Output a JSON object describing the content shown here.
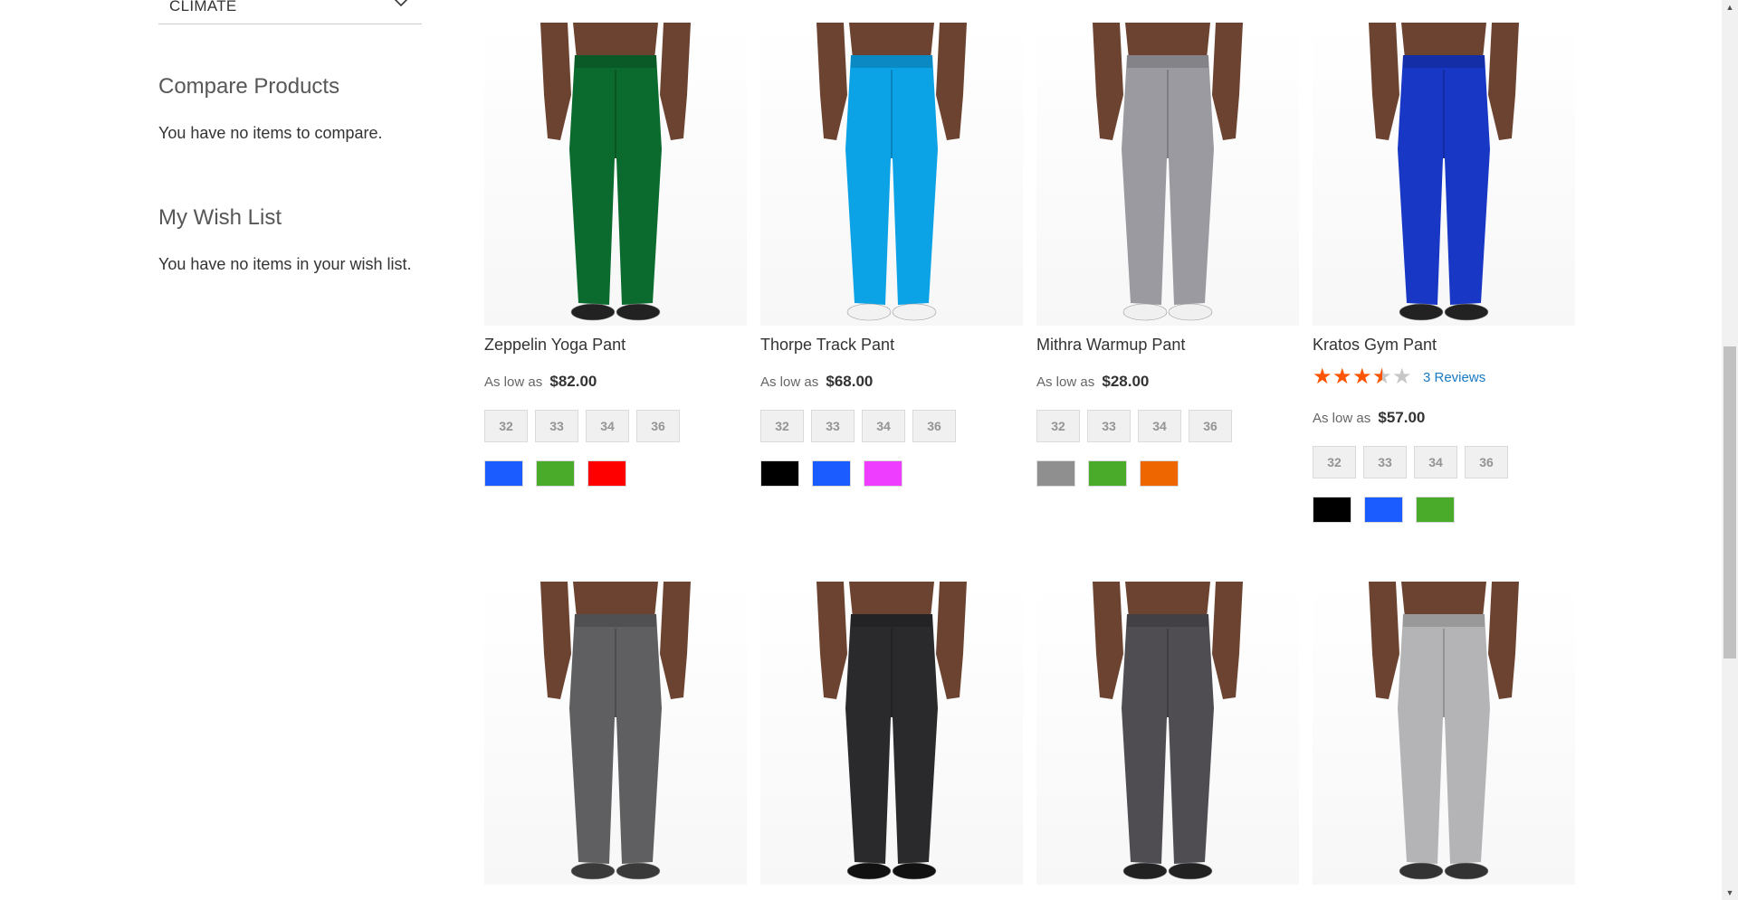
{
  "sidebar": {
    "filter_label": "CLIMATE",
    "compare": {
      "title": "Compare Products",
      "text": "You have no items to compare."
    },
    "wishlist": {
      "title": "My Wish List",
      "text": "You have no items in your wish list."
    }
  },
  "sizes": [
    "32",
    "33",
    "34",
    "36"
  ],
  "products": [
    {
      "name": "Zeppelin Yoga Pant",
      "price_prefix": "As low as",
      "price": "$82.00",
      "pant_color": "#0b6a2d",
      "shoe_color": "#222222",
      "swatches": [
        "#1a5cff",
        "#4aaa2a",
        "#ff0000"
      ]
    },
    {
      "name": "Thorpe Track Pant",
      "price_prefix": "As low as",
      "price": "$68.00",
      "pant_color": "#0ca2e6",
      "shoe_color": "#f2f2f2",
      "swatches": [
        "#000000",
        "#1a5cff",
        "#ef3dff"
      ]
    },
    {
      "name": "Mithra Warmup Pant",
      "price_prefix": "As low as",
      "price": "$28.00",
      "pant_color": "#9a9aa0",
      "shoe_color": "#f0f0f0",
      "swatches": [
        "#8f8f8f",
        "#4aaa2a",
        "#ee6600"
      ]
    },
    {
      "name": "Kratos Gym Pant",
      "price_prefix": "As low as",
      "price": "$57.00",
      "pant_color": "#1737c4",
      "shoe_color": "#222222",
      "rating": 3.5,
      "reviews": "3  Reviews",
      "swatches": [
        "#000000",
        "#1a5cff",
        "#4aaa2a"
      ]
    },
    {
      "name": "",
      "pant_color": "#5f5f62",
      "shoe_color": "#3a3a3a"
    },
    {
      "name": "",
      "pant_color": "#2a2a2c",
      "shoe_color": "#111111"
    },
    {
      "name": "",
      "pant_color": "#4f4c52",
      "shoe_color": "#222222"
    },
    {
      "name": "",
      "pant_color": "#b4b4b6",
      "shoe_color": "#333333"
    }
  ],
  "scrollbar": {
    "position": 0.38
  }
}
